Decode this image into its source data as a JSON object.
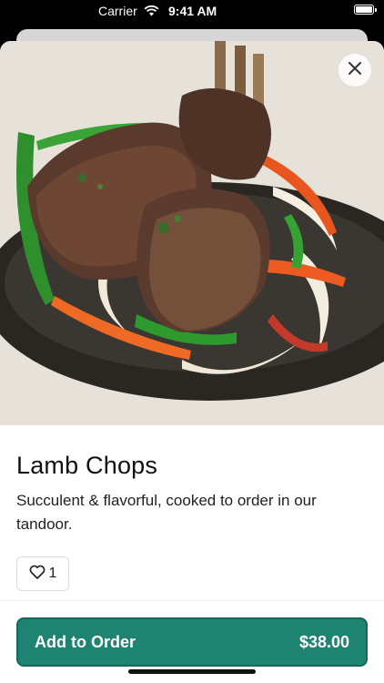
{
  "status_bar": {
    "carrier": "Carrier",
    "time": "9:41 AM"
  },
  "item": {
    "name": "Lamb Chops",
    "description": "Succulent & flavorful, cooked to order in our tandoor.",
    "likes": "1",
    "image_icon": "lamb-chops-photo"
  },
  "actions": {
    "add_label": "Add to Order",
    "price": "$38.00"
  },
  "colors": {
    "accent": "#1f8371"
  }
}
